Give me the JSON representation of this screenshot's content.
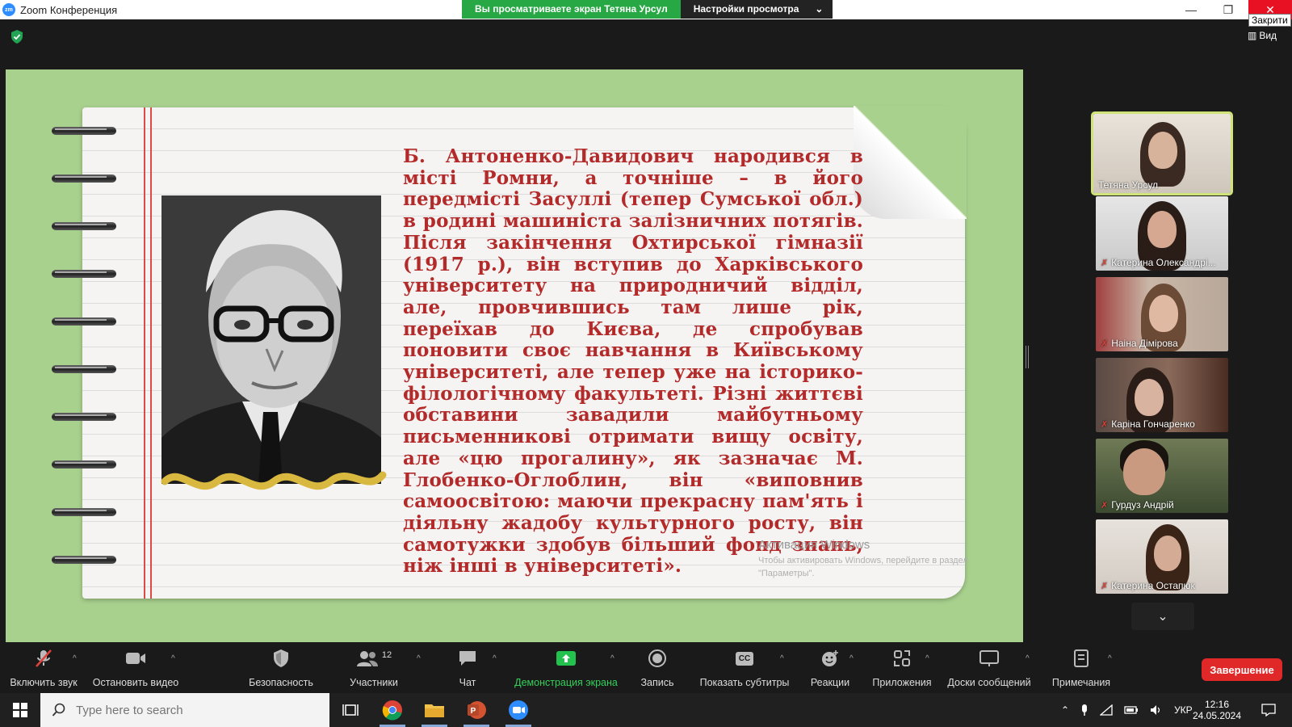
{
  "window": {
    "app_logo": "zm",
    "title": "Zoom Конференция",
    "close_tooltip": "Закрити",
    "view_label": "Вид"
  },
  "share_banner": {
    "viewing_text": "Вы просматриваете экран Тетяна Урсул",
    "view_options_label": "Настройки просмотра"
  },
  "slide": {
    "text": "Б. Антоненко-Давидович народився в місті Ромни, а точніше – в його передмісті Засуллі (тепер Сумської обл.) в родині машиніста залізничних потягів. Після закінчення Охтирської гімназії (1917 р.), він вступив до Харківського університету на природничий відділ, але, провчившись там лише рік, переїхав до Києва, де спробував поновити своє навчання в Київському університеті, але тепер уже на історико-філологічному факультеті. Різні життєві обставини завадили майбутньому письменникові отримати вищу освіту, але «цю прогалину», як зазначає М. Глобенко-Оглоблин, він «виповнив самоосвітою: маючи прекрасну пам'ять і діяльну жадобу культурного росту, він самотужки здобув більший фонд знань, ніж інші в університеті».",
    "accent_color": "#b32a2a",
    "background_color": "#a9d18e"
  },
  "watermark": {
    "title": "Активация Windows",
    "subtitle": "Чтобы активировать Windows, перейдите в раздел \"Параметры\"."
  },
  "participants": [
    {
      "name": "Тетяна Урсул",
      "muted": false,
      "active_speaker": true
    },
    {
      "name": "Катерина Олександрі...",
      "muted": true
    },
    {
      "name": "Наіна Дімірова",
      "muted": true
    },
    {
      "name": "Каріна Гончаренко",
      "muted": true
    },
    {
      "name": "Гурдуз Андрій",
      "muted": true
    },
    {
      "name": "Катерина Остапюк",
      "muted": true
    }
  ],
  "toolbar": {
    "unmute": "Включить звук",
    "stop_video": "Остановить видео",
    "security": "Безопасность",
    "participants": "Участники",
    "participants_count": "12",
    "chat": "Чат",
    "share_screen": "Демонстрация экрана",
    "record": "Запись",
    "captions": "Показать субтитры",
    "captions_badge": "CC",
    "reactions": "Реакции",
    "apps": "Приложения",
    "whiteboards": "Доски сообщений",
    "notes": "Примечания",
    "end": "Завершение"
  },
  "taskbar": {
    "search_placeholder": "Type here to search",
    "language": "УКР",
    "time": "12:16",
    "date": "24.05.2024"
  }
}
